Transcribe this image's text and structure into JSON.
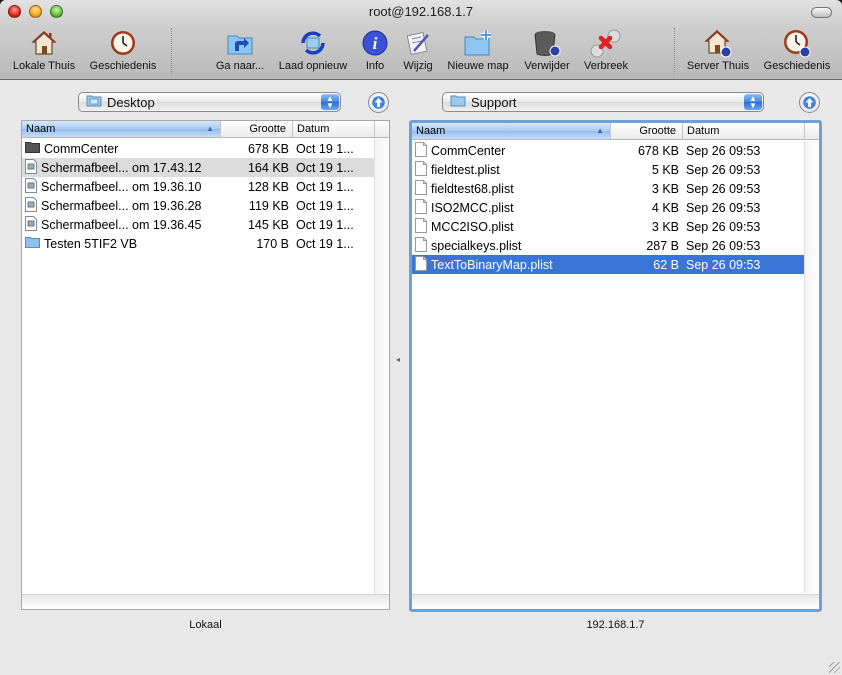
{
  "window": {
    "title": "root@192.168.1.7"
  },
  "toolbar": {
    "items": [
      {
        "label": "Lokale Thuis",
        "icon": "home-icon"
      },
      {
        "label": "Geschiedenis",
        "icon": "history-clock-icon"
      },
      {
        "label": "Ga naar...",
        "icon": "go-to-folder-icon"
      },
      {
        "label": "Laad opnieuw",
        "icon": "reload-icon"
      },
      {
        "label": "Info",
        "icon": "info-icon"
      },
      {
        "label": "Wijzig",
        "icon": "edit-icon"
      },
      {
        "label": "Nieuwe map",
        "icon": "new-folder-icon"
      },
      {
        "label": "Verwijder",
        "icon": "trash-icon"
      },
      {
        "label": "Verbreek",
        "icon": "disconnect-icon"
      },
      {
        "label": "Server Thuis",
        "icon": "server-home-icon"
      },
      {
        "label": "Geschiedenis",
        "icon": "server-history-icon"
      }
    ]
  },
  "local": {
    "folder": "Desktop",
    "pane_label": "Lokaal",
    "columns": {
      "name": "Naam",
      "size": "Grootte",
      "date": "Datum"
    },
    "files": [
      {
        "name": "CommCenter",
        "size": "678 KB",
        "date": "Oct 19 1...",
        "icon": "black-folder-icon"
      },
      {
        "name": "Schermafbeel... om 17.43.12",
        "size": "164 KB",
        "date": "Oct 19 1...",
        "icon": "image-file-icon"
      },
      {
        "name": "Schermafbeel... om 19.36.10",
        "size": "128 KB",
        "date": "Oct 19 1...",
        "icon": "image-file-icon"
      },
      {
        "name": "Schermafbeel... om 19.36.28",
        "size": "119 KB",
        "date": "Oct 19 1...",
        "icon": "image-file-icon"
      },
      {
        "name": "Schermafbeel... om 19.36.45",
        "size": "145 KB",
        "date": "Oct 19 1...",
        "icon": "image-file-icon"
      },
      {
        "name": "Testen 5TIF2 VB",
        "size": "170 B",
        "date": "Oct 19 1...",
        "icon": "folder-icon"
      }
    ],
    "highlighted_index": 1
  },
  "remote": {
    "folder": "Support",
    "pane_label": "192.168.1.7",
    "columns": {
      "name": "Naam",
      "size": "Grootte",
      "date": "Datum"
    },
    "files": [
      {
        "name": "CommCenter",
        "size": "678 KB",
        "date": "Sep 26 09:53",
        "icon": "document-icon"
      },
      {
        "name": "fieldtest.plist",
        "size": "5 KB",
        "date": "Sep 26 09:53",
        "icon": "document-icon"
      },
      {
        "name": "fieldtest68.plist",
        "size": "3 KB",
        "date": "Sep 26 09:53",
        "icon": "document-icon"
      },
      {
        "name": "ISO2MCC.plist",
        "size": "4 KB",
        "date": "Sep 26 09:53",
        "icon": "document-icon"
      },
      {
        "name": "MCC2ISO.plist",
        "size": "3 KB",
        "date": "Sep 26 09:53",
        "icon": "document-icon"
      },
      {
        "name": "specialkeys.plist",
        "size": "287 B",
        "date": "Sep 26 09:53",
        "icon": "document-icon"
      },
      {
        "name": "TextToBinaryMap.plist",
        "size": "62 B",
        "date": "Sep 26 09:53",
        "icon": "document-icon"
      }
    ],
    "selected_index": 6
  },
  "colors": {
    "selection": "#3875d7",
    "focus_ring": "#6fa1d6",
    "highlight_row": "#dcdcdc"
  }
}
